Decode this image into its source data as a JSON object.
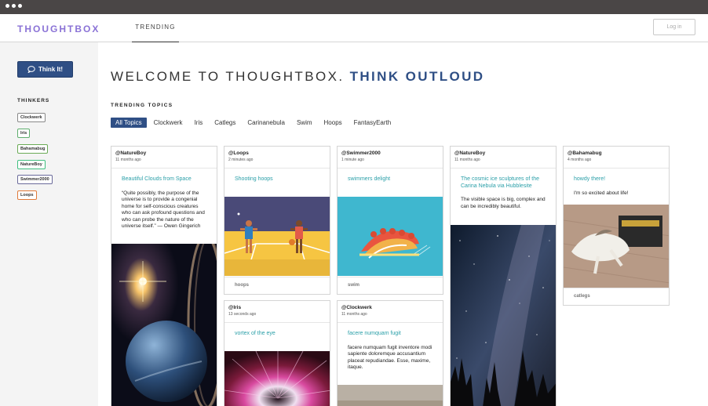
{
  "app": {
    "logo": "THOUGHTBOX",
    "nav_tab": "TRENDING",
    "login_label": "Log in"
  },
  "sidebar": {
    "think_button": "Think It!",
    "thinkers_heading": "THINKERS",
    "thinkers": [
      {
        "name": "Clockwerk",
        "color": "#888888"
      },
      {
        "name": "Iris",
        "color": "#5fae6e"
      },
      {
        "name": "Bahamabug",
        "color": "#6aaa55"
      },
      {
        "name": "NatureBoy",
        "color": "#3fbf7f"
      },
      {
        "name": "Swimmer2000",
        "color": "#6a6a9a"
      },
      {
        "name": "Loops",
        "color": "#e07a3a"
      }
    ]
  },
  "main": {
    "welcome_plain": "WELCOME TO THOUGHTBOX.",
    "welcome_accent": "THINK OUTLOUD",
    "trending_heading": "TRENDING TOPICS",
    "topics": [
      "All Topics",
      "Clockwerk",
      "Iris",
      "Catlegs",
      "Carinanebula",
      "Swim",
      "Hoops",
      "FantasyEarth"
    ]
  },
  "cards": [
    {
      "user": "@NatureBoy",
      "time": "11 months ago",
      "title": "Beautiful Clouds from Space",
      "body": "“Quite possibly, the purpose of the universe is to provide a congenial home for self-conscious creatures who can ask profound questions and who can probe the nature of the universe itself.” — Owen Gingerich",
      "tag": ""
    },
    {
      "user": "@Loops",
      "time": "2 minutes ago",
      "title": "Shooting hoops",
      "body": "",
      "tag": "hoops"
    },
    {
      "user": "@Swimmer2000",
      "time": "1 minute ago",
      "title": "swimmers delight",
      "body": "",
      "tag": "swim"
    },
    {
      "user": "@NatureBoy",
      "time": "11 months ago",
      "title": "The cosmic ice sculptures of the Carina Nebula via Hubblesite",
      "body": "The visible space is big, complex and can be incredibly beautiful.",
      "tag": ""
    },
    {
      "user": "@Bahamabug",
      "time": "4 months ago",
      "title": "howdy there!",
      "body": "I'm so excited about life!",
      "tag": "catlegs"
    },
    {
      "user": "@Iris",
      "time": "13 seconds ago",
      "title": "vortex of the eye",
      "body": "",
      "tag": ""
    },
    {
      "user": "@Clockwerk",
      "time": "11 months ago",
      "title": "facere numquam fugit",
      "body": "facere numquam fugit inventore modi sapiente doloremque accusantium placeat repudiandae. Esse, maxime, itaque.",
      "tag": ""
    }
  ],
  "colors": {
    "accent": "#2f4f85",
    "logo": "#8a72d6",
    "link": "#2a9fa8"
  }
}
